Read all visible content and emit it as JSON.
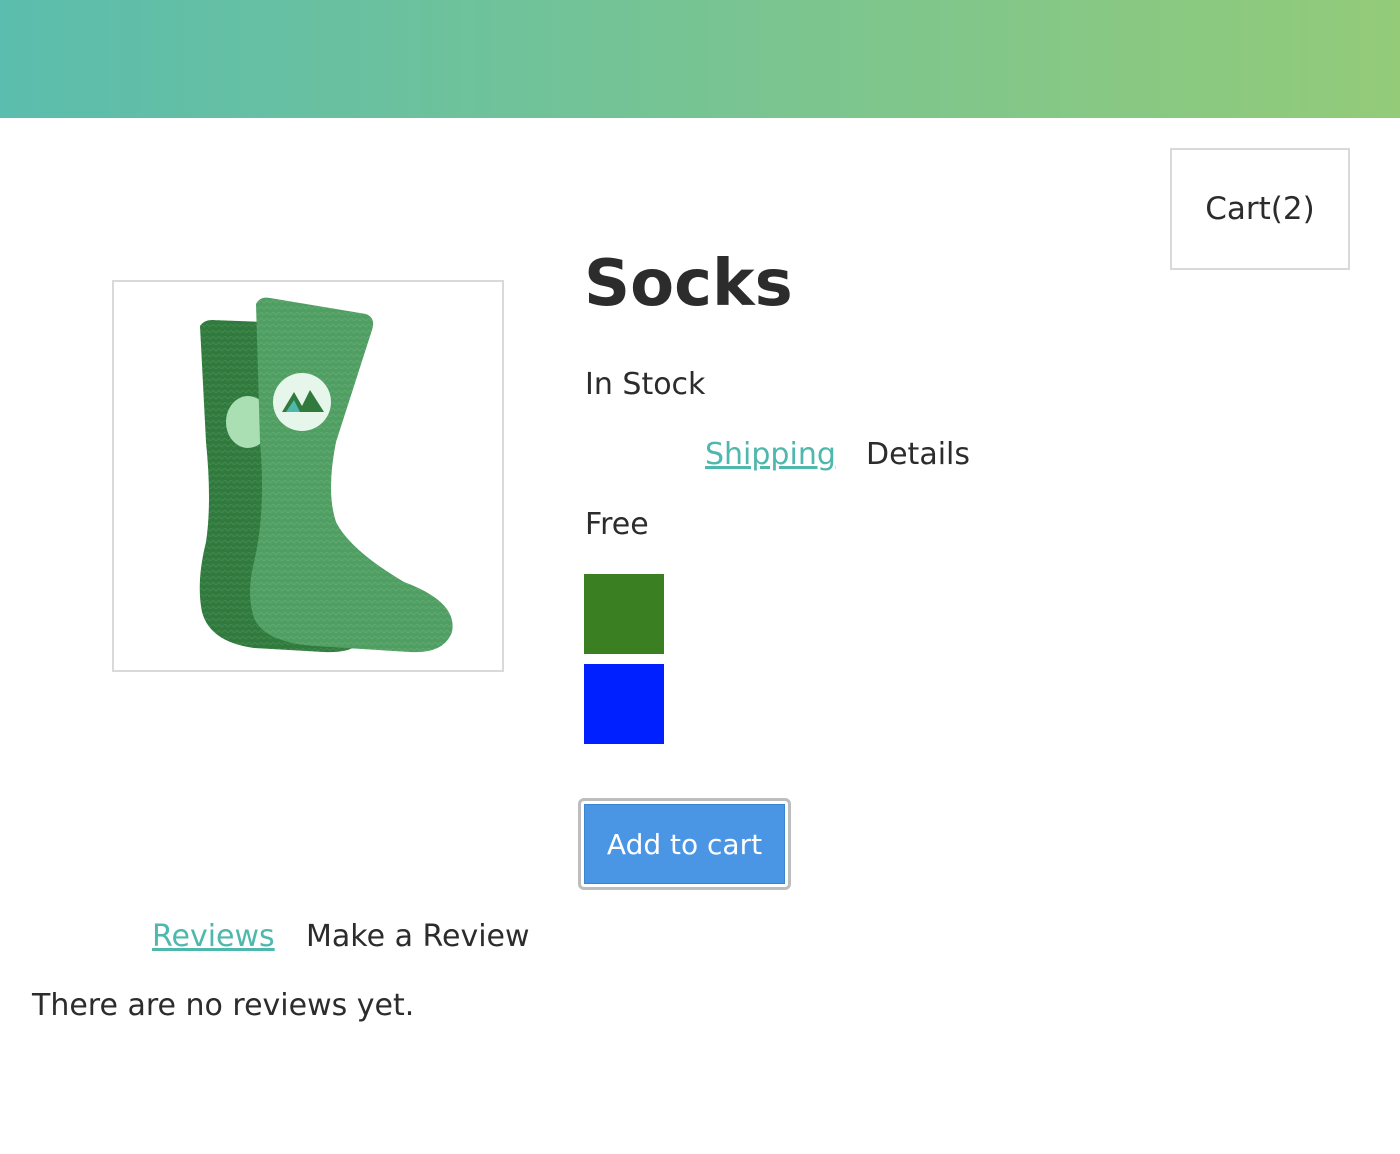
{
  "header": {
    "gradient_start": "#5bbdad",
    "gradient_end": "#93cb79"
  },
  "cart": {
    "label": "Cart(2)"
  },
  "product": {
    "title": "Socks",
    "image_icon": "green-socks-image",
    "stock_status": "In Stock",
    "tabs": [
      {
        "label": "Shipping",
        "active": true
      },
      {
        "label": "Details",
        "active": false
      }
    ],
    "shipping_info": "Free",
    "variants": [
      {
        "color": "#3a8022",
        "name": "green-swatch"
      },
      {
        "color": "#0020ff",
        "name": "blue-swatch"
      }
    ],
    "add_to_cart_label": "Add to cart",
    "add_to_cart_color": "#4a96e4"
  },
  "reviews": {
    "tabs": [
      {
        "label": "Reviews",
        "active": true
      },
      {
        "label": "Make a Review",
        "active": false
      }
    ],
    "empty_message": "There are no reviews yet."
  },
  "accent_color": "#4fb8ac"
}
